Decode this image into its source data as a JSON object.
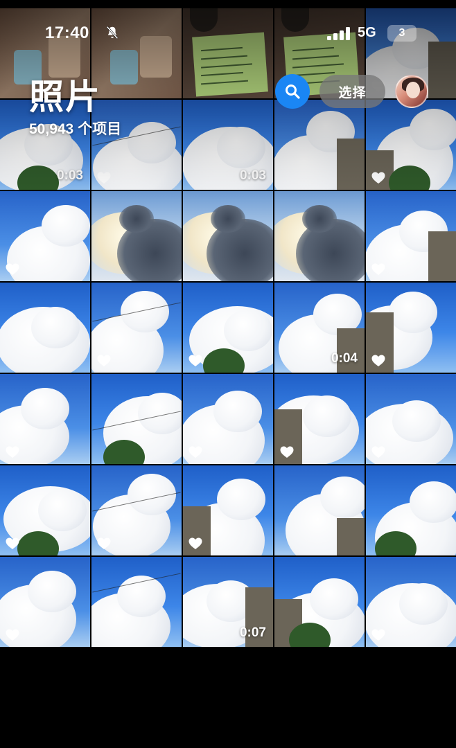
{
  "status_bar": {
    "time": "17:40",
    "network": "5G",
    "battery": "3",
    "icons": [
      "bell-slash-icon",
      "cellular-signal-icon"
    ]
  },
  "header": {
    "title": "照片",
    "item_count": "50,943 个项目",
    "select_label": "选择",
    "search_icon": "magnifying-glass-icon",
    "profile": "avatar"
  },
  "colors": {
    "accent": "#1a86f4",
    "select_button_bg": "#787878",
    "background": "#000000"
  },
  "grid": {
    "columns": 5,
    "tiles": [
      {
        "kind": "indoor",
        "favorite": false,
        "duration": ""
      },
      {
        "kind": "indoor",
        "favorite": false,
        "duration": ""
      },
      {
        "kind": "note",
        "favorite": false,
        "duration": ""
      },
      {
        "kind": "note",
        "favorite": false,
        "duration": ""
      },
      {
        "kind": "sky-cloud",
        "favorite": true,
        "duration": ""
      },
      {
        "kind": "sky-cloud",
        "favorite": false,
        "duration": "0:03"
      },
      {
        "kind": "sky-cloud",
        "favorite": true,
        "duration": ""
      },
      {
        "kind": "sky-cloud",
        "favorite": false,
        "duration": "0:03"
      },
      {
        "kind": "sky-cloud",
        "favorite": false,
        "duration": ""
      },
      {
        "kind": "sky-cloud",
        "favorite": true,
        "duration": ""
      },
      {
        "kind": "sky-cloud",
        "favorite": true,
        "duration": ""
      },
      {
        "kind": "storm",
        "favorite": false,
        "duration": ""
      },
      {
        "kind": "storm",
        "favorite": false,
        "duration": ""
      },
      {
        "kind": "storm",
        "favorite": false,
        "duration": ""
      },
      {
        "kind": "sky-cloud",
        "favorite": true,
        "duration": ""
      },
      {
        "kind": "sky-cloud",
        "favorite": false,
        "duration": ""
      },
      {
        "kind": "sky-cloud",
        "favorite": true,
        "duration": ""
      },
      {
        "kind": "sky-cloud",
        "favorite": true,
        "duration": ""
      },
      {
        "kind": "sky-cloud",
        "favorite": false,
        "duration": "0:04"
      },
      {
        "kind": "sky-cloud",
        "favorite": true,
        "duration": ""
      },
      {
        "kind": "sky-cloud",
        "favorite": true,
        "duration": ""
      },
      {
        "kind": "sky-cloud",
        "favorite": false,
        "duration": ""
      },
      {
        "kind": "sky-cloud",
        "favorite": true,
        "duration": ""
      },
      {
        "kind": "sky-cloud",
        "favorite": true,
        "duration": ""
      },
      {
        "kind": "sky-cloud",
        "favorite": true,
        "duration": ""
      },
      {
        "kind": "sky-cloud",
        "favorite": true,
        "duration": ""
      },
      {
        "kind": "sky-cloud",
        "favorite": true,
        "duration": ""
      },
      {
        "kind": "sky-cloud",
        "favorite": true,
        "duration": ""
      },
      {
        "kind": "sky-cloud",
        "favorite": false,
        "duration": ""
      },
      {
        "kind": "sky-cloud",
        "favorite": false,
        "duration": ""
      },
      {
        "kind": "sky-cloud",
        "favorite": true,
        "duration": ""
      },
      {
        "kind": "sky-cloud",
        "favorite": false,
        "duration": ""
      },
      {
        "kind": "sky-cloud",
        "favorite": false,
        "duration": "0:07"
      },
      {
        "kind": "sky-cloud",
        "favorite": false,
        "duration": ""
      },
      {
        "kind": "sky-cloud",
        "favorite": true,
        "duration": ""
      }
    ]
  }
}
